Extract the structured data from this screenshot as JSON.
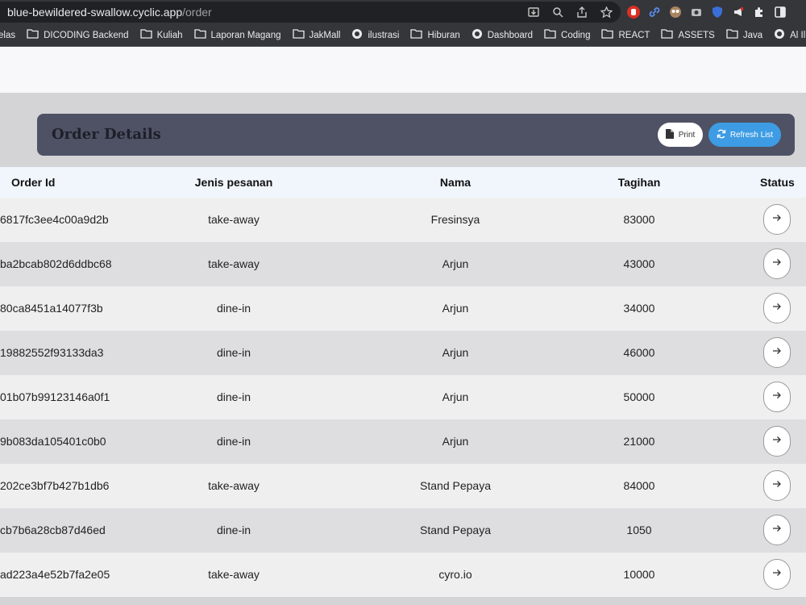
{
  "browser": {
    "url_host": "blue-bewildered-swallow.cyclic.app",
    "url_path": "/order",
    "bookmarks": [
      {
        "label": "elas",
        "icon": "folder-icon"
      },
      {
        "label": "DICODING Backend",
        "icon": "folder-icon"
      },
      {
        "label": "Kuliah",
        "icon": "folder-icon"
      },
      {
        "label": "Laporan Magang",
        "icon": "folder-icon"
      },
      {
        "label": "JakMall",
        "icon": "folder-icon"
      },
      {
        "label": "ilustrasi",
        "icon": "site-icon"
      },
      {
        "label": "Hiburan",
        "icon": "folder-icon"
      },
      {
        "label": "Dashboard",
        "icon": "site-icon"
      },
      {
        "label": "Coding",
        "icon": "folder-icon"
      },
      {
        "label": "REACT",
        "icon": "folder-icon"
      },
      {
        "label": "ASSETS",
        "icon": "folder-icon"
      },
      {
        "label": "Java",
        "icon": "folder-icon"
      },
      {
        "label": "Al Ilmu (B",
        "icon": "site-icon"
      }
    ]
  },
  "header": {
    "title": "Order Details",
    "print_label": "Print",
    "refresh_label": "Refresh List"
  },
  "table": {
    "columns": [
      "Order Id",
      "Jenis pesanan",
      "Nama",
      "Tagihan",
      "Status"
    ],
    "rows": [
      {
        "order_id": "6817fc3ee4c00a9d2b",
        "jenis": "take-away",
        "nama": "Fresinsya",
        "tagihan": "83000"
      },
      {
        "order_id": "ba2bcab802d6ddbc68",
        "jenis": "take-away",
        "nama": "Arjun",
        "tagihan": "43000"
      },
      {
        "order_id": "80ca8451a14077f3b",
        "jenis": "dine-in",
        "nama": "Arjun",
        "tagihan": "34000"
      },
      {
        "order_id": "19882552f93133da3",
        "jenis": "dine-in",
        "nama": "Arjun",
        "tagihan": "46000"
      },
      {
        "order_id": "01b07b99123146a0f1",
        "jenis": "dine-in",
        "nama": "Arjun",
        "tagihan": "50000"
      },
      {
        "order_id": "9b083da105401c0b0",
        "jenis": "dine-in",
        "nama": "Arjun",
        "tagihan": "21000"
      },
      {
        "order_id": "202ce3bf7b427b1db6",
        "jenis": "take-away",
        "nama": "Stand Pepaya",
        "tagihan": "84000"
      },
      {
        "order_id": "cb7b6a28cb87d46ed",
        "jenis": "dine-in",
        "nama": "Stand Pepaya",
        "tagihan": "1050"
      },
      {
        "order_id": "ad223a4e52b7fa2e05",
        "jenis": "take-away",
        "nama": "cyro.io",
        "tagihan": "10000"
      }
    ]
  },
  "colors": {
    "header_card": "#4f5264",
    "refresh_button": "#3d9ce3",
    "row_light": "#efeff0",
    "row_dark": "#dedde0"
  }
}
